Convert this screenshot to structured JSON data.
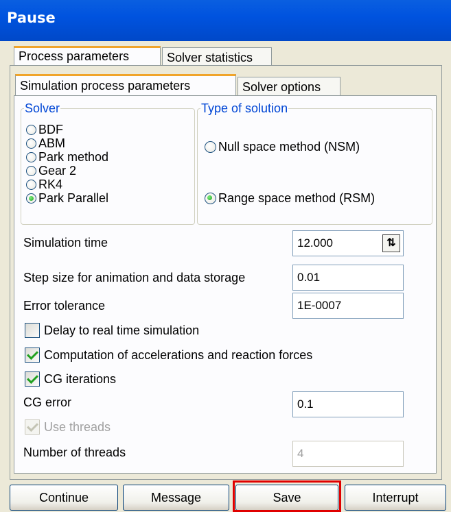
{
  "window": {
    "title": "Pause"
  },
  "outer_tabs": [
    {
      "label": "Process parameters"
    },
    {
      "label": "Solver statistics"
    }
  ],
  "inner_tabs": [
    {
      "label": "Simulation process parameters"
    },
    {
      "label": "Solver options"
    }
  ],
  "solver": {
    "legend": "Solver",
    "options": [
      "BDF",
      "ABM",
      "Park method",
      "Gear 2",
      "RK4",
      "Park Parallel"
    ],
    "selected": "Park Parallel"
  },
  "solution_type": {
    "legend": "Type of solution",
    "options": [
      "Null space method (NSM)",
      "Range space method (RSM)"
    ],
    "selected": "Range space method (RSM)"
  },
  "fields": {
    "simulation_time": {
      "label": "Simulation time",
      "value": "12.000"
    },
    "step_size": {
      "label": "Step size for animation and data storage",
      "value": "0.01"
    },
    "error_tolerance": {
      "label": "Error tolerance",
      "value": "1E-0007"
    },
    "cg_error": {
      "label": "CG error",
      "value": "0.1"
    },
    "num_threads": {
      "label": "Number of threads",
      "value": "4"
    }
  },
  "checkboxes": {
    "delay_realtime": {
      "label": "Delay to real time simulation",
      "checked": false
    },
    "accelerations": {
      "label": "Computation of accelerations and reaction forces",
      "checked": true
    },
    "cg_iterations": {
      "label": "CG iterations",
      "checked": true
    },
    "use_threads": {
      "label": "Use threads",
      "checked": true,
      "disabled": true
    }
  },
  "buttons": {
    "continue": "Continue",
    "message": "Message",
    "save": "Save",
    "interrupt": "Interrupt"
  },
  "colors": {
    "title_bar": "#0053df",
    "group_legend": "#0046d5",
    "highlight": "#e00000",
    "active_tab_accent": "#f0a42a"
  }
}
